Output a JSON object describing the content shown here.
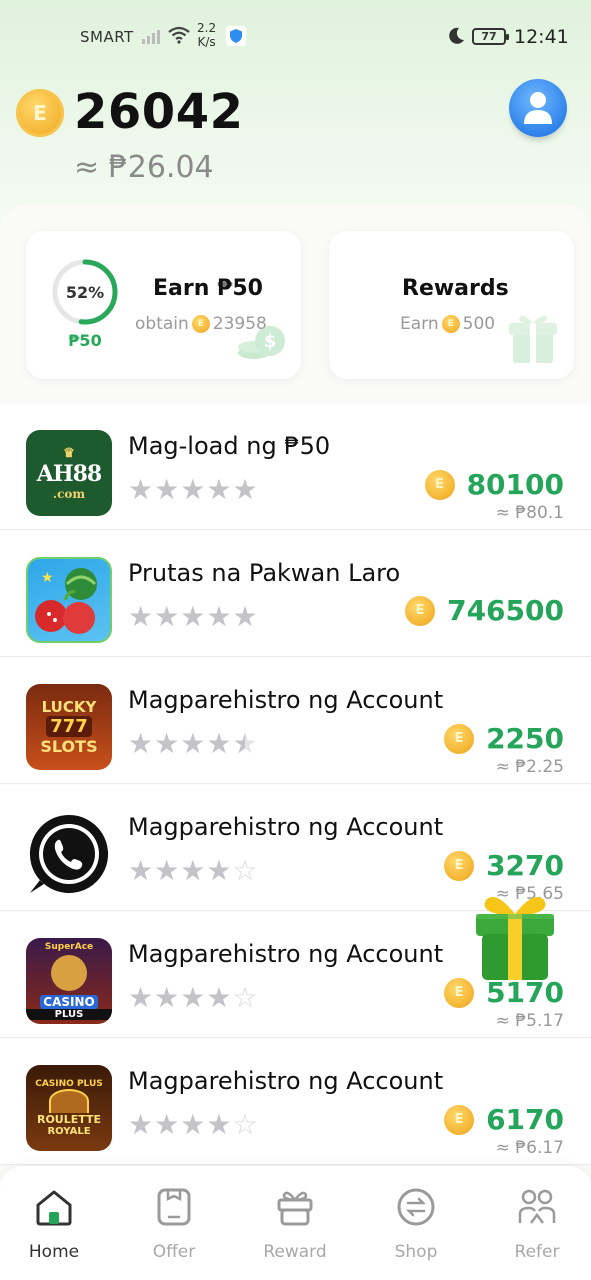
{
  "status_bar": {
    "carrier": "SMART",
    "speed_value": "2.2",
    "speed_unit": "K/s",
    "battery": "77",
    "time": "12:41"
  },
  "header": {
    "coin_balance": "26042",
    "peso_equivalent": "≈ ₱26.04",
    "coin_symbol": "E"
  },
  "cards": {
    "earn": {
      "progress_percent": 52,
      "progress_label": "52%",
      "amount_label": "₱50",
      "title": "Earn ₱50",
      "sub_prefix": "obtain",
      "sub_value": "23958"
    },
    "rewards": {
      "title": "Rewards",
      "sub_prefix": "Earn",
      "sub_value": "500"
    }
  },
  "offers": [
    {
      "title": "Mag-load ng ₱50",
      "icon": "ah88-logo",
      "icon_text": "AH88",
      "icon_subtext": ".com",
      "rating": 5.0,
      "coins": "80100",
      "peso": "≈ ₱80.1"
    },
    {
      "title": "Prutas na Pakwan Laro",
      "icon": "fruit-game-logo",
      "icon_text": "",
      "icon_subtext": "",
      "rating": 5.0,
      "coins": "746500",
      "peso": ""
    },
    {
      "title": "Magparehistro ng Account",
      "icon": "lucky-slots-logo",
      "icon_text": "LUCKY",
      "icon_subtext": "SLOTS",
      "rating": 4.5,
      "coins": "2250",
      "peso": "≈ ₱2.25"
    },
    {
      "title": "Magparehistro ng Account",
      "icon": "whatsapp-logo",
      "icon_text": "",
      "icon_subtext": "",
      "rating": 4.0,
      "coins": "3270",
      "peso": "≈ ₱5.65"
    },
    {
      "title": "Magparehistro ng Account",
      "icon": "superace-casino-logo",
      "icon_text": "CASINO",
      "icon_subtext": "PLUS",
      "rating": 4.0,
      "coins": "5170",
      "peso": "≈ ₱5.17"
    },
    {
      "title": "Magparehistro ng Account",
      "icon": "roulette-royale-logo",
      "icon_text": "ROULETTE",
      "icon_subtext": "ROYALE",
      "rating": 4.0,
      "coins": "6170",
      "peso": "≈ ₱6.17"
    }
  ],
  "nav": [
    {
      "label": "Home",
      "icon": "home-icon",
      "active": true
    },
    {
      "label": "Offer",
      "icon": "offer-icon",
      "active": false
    },
    {
      "label": "Reward",
      "icon": "gift-icon",
      "active": false
    },
    {
      "label": "Shop",
      "icon": "shop-icon",
      "active": false
    },
    {
      "label": "Refer",
      "icon": "refer-icon",
      "active": false
    }
  ],
  "colors": {
    "accent_green": "#25a55a",
    "coin_gold": "#f4b634",
    "avatar_blue": "#2b7fe8"
  }
}
